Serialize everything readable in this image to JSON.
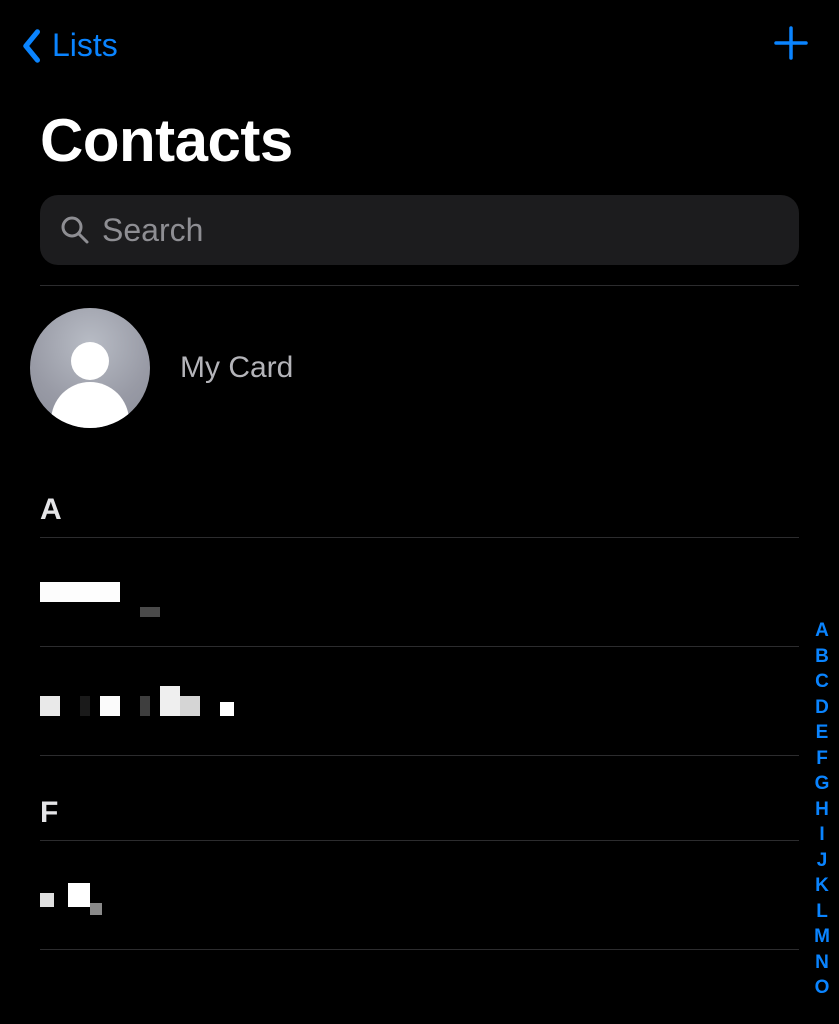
{
  "nav": {
    "back_label": "Lists"
  },
  "title": "Contacts",
  "search": {
    "placeholder": "Search",
    "value": ""
  },
  "my_card": {
    "label": "My Card"
  },
  "sections": [
    {
      "letter": "A",
      "contacts": [
        {
          "name": ""
        },
        {
          "name": ""
        }
      ]
    },
    {
      "letter": "F",
      "contacts": [
        {
          "name": ""
        }
      ]
    }
  ],
  "index_letters": [
    "A",
    "B",
    "C",
    "D",
    "E",
    "F",
    "G",
    "H",
    "I",
    "J",
    "K",
    "L",
    "M",
    "N",
    "O"
  ]
}
